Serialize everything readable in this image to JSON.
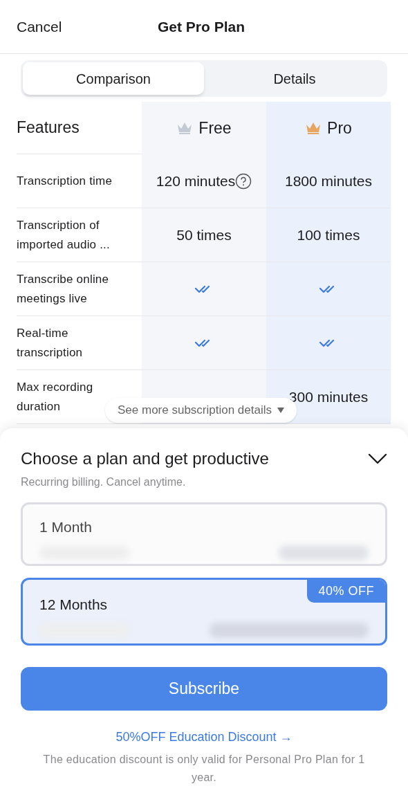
{
  "header": {
    "cancel": "Cancel",
    "title": "Get Pro Plan"
  },
  "tabs": [
    {
      "label": "Comparison",
      "selected": true
    },
    {
      "label": "Details",
      "selected": false
    }
  ],
  "table": {
    "columns": [
      {
        "label": "Features"
      },
      {
        "label": "Free",
        "color": "#c3cad4"
      },
      {
        "label": "Pro",
        "color": "#e8a55f"
      }
    ],
    "rows": [
      {
        "feature": "Transcription time",
        "free": {
          "kind": "text",
          "text": "120 minutes",
          "info": true
        },
        "pro": {
          "kind": "text",
          "text": "1800 minutes"
        }
      },
      {
        "feature": "Transcription of imported audio ...",
        "free": {
          "kind": "text",
          "text": "50 times"
        },
        "pro": {
          "kind": "text",
          "text": "100 times"
        }
      },
      {
        "feature": "Transcribe online meetings live",
        "free": {
          "kind": "check"
        },
        "pro": {
          "kind": "check"
        }
      },
      {
        "feature": "Real-time transcription",
        "free": {
          "kind": "check"
        },
        "pro": {
          "kind": "check"
        }
      },
      {
        "feature": "Max recording duration",
        "pro": {
          "kind": "text",
          "text": "300 minutes"
        }
      }
    ]
  },
  "more_details": "See more subscription details",
  "sheet": {
    "title": "Choose a plan and get productive",
    "subtitle": "Recurring billing. Cancel anytime.",
    "plans": [
      {
        "name": "1 Month",
        "selected": false
      },
      {
        "name": "12 Months",
        "selected": true,
        "badge": "40% OFF"
      }
    ],
    "subscribe": "Subscribe",
    "education_link": "50%OFF Education Discount →",
    "note": "The education discount is only valid for Personal Pro Plan for 1 year."
  }
}
